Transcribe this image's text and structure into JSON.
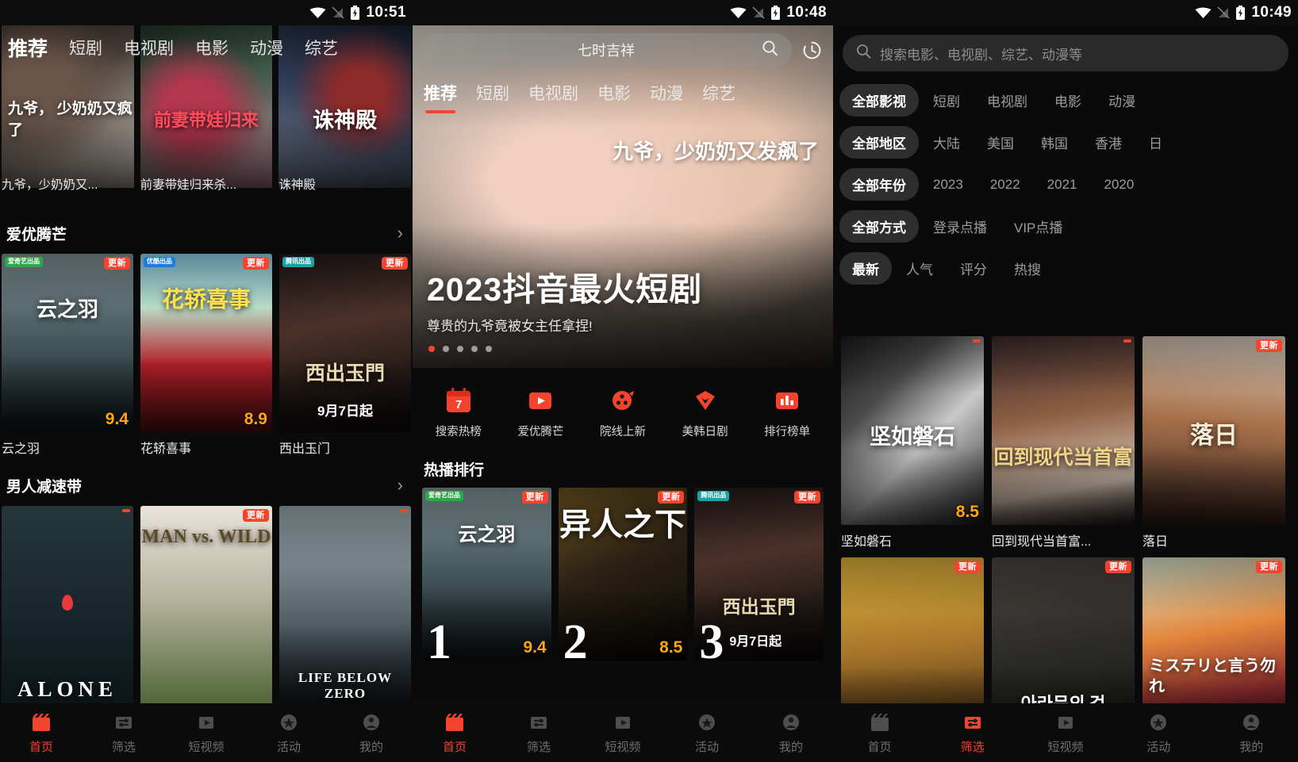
{
  "screens": [
    {
      "status": {
        "time": "10:51",
        "wifi": "wifi-icon",
        "signal": "signal-icon",
        "battery": "battery-charging-icon"
      },
      "tabs": [
        {
          "label": "推荐",
          "active": true
        },
        {
          "label": "短剧",
          "active": false
        },
        {
          "label": "电视剧",
          "active": false
        },
        {
          "label": "电影",
          "active": false
        },
        {
          "label": "动漫",
          "active": false
        },
        {
          "label": "综艺",
          "active": false
        }
      ],
      "hero_cards": [
        {
          "title": "九爷，少奶奶又...",
          "art": "g1",
          "overlay": "九爷，\n少奶奶又疯了"
        },
        {
          "title": "前妻带娃归来杀...",
          "art": "g2",
          "overlay": "前妻带娃归来"
        },
        {
          "title": "诛神殿",
          "art": "g3",
          "overlay": "诛神殿"
        }
      ],
      "sections": [
        {
          "title": "爱优腾芒",
          "arrow": "chevron-right-icon",
          "cards": [
            {
              "title": "云之羽",
              "score": "9.4",
              "badge": "更新",
              "source": "爱奇艺出品",
              "source_color": "#2ba84a",
              "art": "g-mist",
              "mark": "云之羽"
            },
            {
              "title": "花轿喜事",
              "score": "8.9",
              "badge": "更新",
              "source": "优酷出品",
              "source_color": "#1c7ce0",
              "art": "g-red",
              "mark": "花轿喜事"
            },
            {
              "title": "西出玉门",
              "score": "",
              "badge": "更新",
              "source": "腾讯出品",
              "source_color": "#1aa3a3",
              "art": "g-xcy",
              "mark": "西出玉門"
            }
          ]
        },
        {
          "title": "男人减速带",
          "arrow": "chevron-right-icon",
          "cards": [
            {
              "title": "",
              "score": "",
              "badge": "",
              "source": "",
              "source_color": "",
              "art": "g-forest",
              "mark": "ALONE"
            },
            {
              "title": "",
              "score": "",
              "badge": "更新",
              "source": "",
              "source_color": "",
              "art": "g-wild",
              "mark": "MAN vs. WILD"
            },
            {
              "title": "",
              "score": "",
              "badge": "",
              "source": "",
              "source_color": "",
              "art": "g-snow",
              "mark": "LIFE BELOW ZERO"
            }
          ]
        }
      ],
      "nav": [
        {
          "label": "首页",
          "icon": "clapperboard-icon",
          "active": true
        },
        {
          "label": "筛选",
          "icon": "filter-icon",
          "active": false
        },
        {
          "label": "短视频",
          "icon": "play-icon",
          "active": false
        },
        {
          "label": "活动",
          "icon": "star-icon",
          "active": false
        },
        {
          "label": "我的",
          "icon": "person-icon",
          "active": false
        }
      ]
    },
    {
      "status": {
        "time": "10:48"
      },
      "search": {
        "keyword": "七时吉祥",
        "search_icon": "search-icon",
        "history_icon": "history-clock-icon"
      },
      "tabs": [
        {
          "label": "推荐",
          "active": true
        },
        {
          "label": "短剧",
          "active": false
        },
        {
          "label": "电视剧",
          "active": false
        },
        {
          "label": "电影",
          "active": false
        },
        {
          "label": "动漫",
          "active": false
        },
        {
          "label": "综艺",
          "active": false
        }
      ],
      "banner": {
        "title": "2023抖音最火短剧",
        "subtitle": "尊贵的九爷竟被女主任拿捏!",
        "overlay_text": "九爷，少奶奶又发飙了",
        "dots": 5,
        "active_dot": 0
      },
      "quick_actions": [
        {
          "label": "搜索热榜",
          "icon": "calendar-7-icon"
        },
        {
          "label": "爱优腾芒",
          "icon": "play-box-icon"
        },
        {
          "label": "院线上新",
          "icon": "film-reel-icon"
        },
        {
          "label": "美韩日剧",
          "icon": "diamond-heart-icon"
        },
        {
          "label": "排行榜单",
          "icon": "bar-chart-icon"
        }
      ],
      "rank_heading": "热播排行",
      "rank_cards": [
        {
          "rank": "1",
          "score": "9.4",
          "badge": "更新",
          "source": "爱奇艺出品",
          "source_color": "#2ba84a",
          "art": "g-mist",
          "mark": "云之羽"
        },
        {
          "rank": "2",
          "score": "8.5",
          "badge": "更新",
          "source": "",
          "source_color": "",
          "art": "g-dark1",
          "mark": "异人之下"
        },
        {
          "rank": "3",
          "score": "",
          "badge": "更新",
          "source": "腾讯出品",
          "source_color": "#1aa3a3",
          "art": "g-xcy",
          "mark": "西出玉門"
        }
      ],
      "nav": [
        {
          "label": "首页",
          "icon": "clapperboard-icon",
          "active": true
        },
        {
          "label": "筛选",
          "icon": "filter-icon",
          "active": false
        },
        {
          "label": "短视频",
          "icon": "play-icon",
          "active": false
        },
        {
          "label": "活动",
          "icon": "star-icon",
          "active": false
        },
        {
          "label": "我的",
          "icon": "person-icon",
          "active": false
        }
      ]
    },
    {
      "status": {
        "time": "10:49"
      },
      "search": {
        "placeholder": "搜索电影、电视剧、综艺、动漫等",
        "search_icon": "search-icon"
      },
      "filter_rows": [
        {
          "name": "type",
          "options": [
            {
              "label": "全部影视",
              "selected": true
            },
            {
              "label": "短剧",
              "selected": false
            },
            {
              "label": "电视剧",
              "selected": false
            },
            {
              "label": "电影",
              "selected": false
            },
            {
              "label": "动漫",
              "selected": false
            }
          ]
        },
        {
          "name": "region",
          "options": [
            {
              "label": "全部地区",
              "selected": true
            },
            {
              "label": "大陆",
              "selected": false
            },
            {
              "label": "美国",
              "selected": false
            },
            {
              "label": "韩国",
              "selected": false
            },
            {
              "label": "香港",
              "selected": false
            },
            {
              "label": "日",
              "selected": false
            }
          ]
        },
        {
          "name": "year",
          "options": [
            {
              "label": "全部年份",
              "selected": true
            },
            {
              "label": "2023",
              "selected": false
            },
            {
              "label": "2022",
              "selected": false
            },
            {
              "label": "2021",
              "selected": false
            },
            {
              "label": "2020",
              "selected": false
            }
          ]
        },
        {
          "name": "mode",
          "options": [
            {
              "label": "全部方式",
              "selected": true
            },
            {
              "label": "登录点播",
              "selected": false
            },
            {
              "label": "VIP点播",
              "selected": false
            }
          ]
        },
        {
          "name": "sort",
          "options": [
            {
              "label": "最新",
              "selected": true
            },
            {
              "label": "人气",
              "selected": false
            },
            {
              "label": "评分",
              "selected": false
            },
            {
              "label": "热搜",
              "selected": false
            }
          ]
        }
      ],
      "results": [
        {
          "title": "坚如磐石",
          "score": "8.5",
          "badge": "",
          "art": "g-bw",
          "mark": "坚如磐石"
        },
        {
          "title": "回到现代当首富...",
          "score": "",
          "badge": "",
          "art": "g-hui",
          "mark": "回到现代当首富"
        },
        {
          "title": "落日",
          "score": "",
          "badge": "更新",
          "art": "g-luori",
          "mark": "落日"
        },
        {
          "title": "",
          "score": "",
          "badge": "更新",
          "art": "g-hair",
          "mark": ""
        },
        {
          "title": "",
          "score": "",
          "badge": "更新",
          "art": "g-ara",
          "mark": "아라문의 검"
        },
        {
          "title": "",
          "score": "",
          "badge": "更新",
          "art": "g-jp",
          "mark": "ミステリと言う勿れ"
        }
      ],
      "nav": [
        {
          "label": "首页",
          "icon": "clapperboard-icon",
          "active": false
        },
        {
          "label": "筛选",
          "icon": "filter-icon",
          "active": true
        },
        {
          "label": "短视频",
          "icon": "play-icon",
          "active": false
        },
        {
          "label": "活动",
          "icon": "star-icon",
          "active": false
        },
        {
          "label": "我的",
          "icon": "person-icon",
          "active": false
        }
      ]
    }
  ],
  "colors": {
    "accent": "#f5442e",
    "score": "#ffa516",
    "bg": "#0a0a0a",
    "chip_selected_bg": "#2e2e2e"
  }
}
